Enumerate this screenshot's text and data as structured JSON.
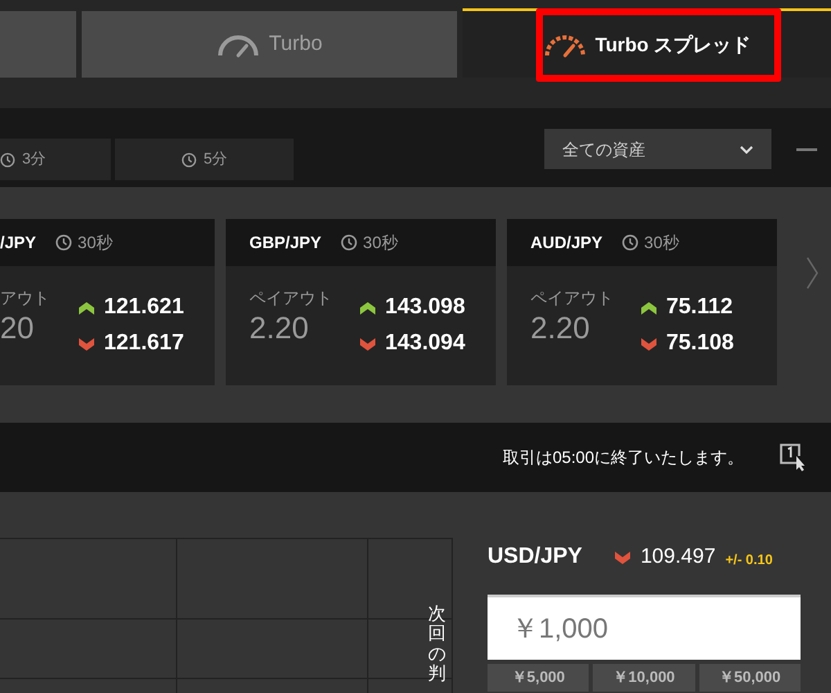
{
  "mode_tabs": [
    {
      "selected": false
    },
    {
      "label": "Turbo",
      "selected": false
    },
    {
      "label": "Turbo スプレッド",
      "selected": true,
      "highlighted": true
    }
  ],
  "duration_tabs": [
    {
      "label": "3分"
    },
    {
      "label": "5分"
    }
  ],
  "asset_filter": {
    "value": "全ての資産"
  },
  "cards": [
    {
      "kind": "partial",
      "pair": "/JPY",
      "duration": "30秒",
      "payout_label": "アウト",
      "payout": "20",
      "up_price": "121.621",
      "down_price": "121.617"
    },
    {
      "kind": "full",
      "pair": "GBP/JPY",
      "duration": "30秒",
      "payout_label": "ペイアウト",
      "payout": "2.20",
      "up_price": "143.098",
      "down_price": "143.094"
    },
    {
      "kind": "full",
      "pair": "AUD/JPY",
      "duration": "30秒",
      "payout_label": "ペイアウト",
      "payout": "2.20",
      "up_price": "75.112",
      "down_price": "75.108"
    }
  ],
  "notice": "取引は05:00に終了いたします。",
  "chart_side_label": "次回の判",
  "trade_panel": {
    "pair": "USD/JPY",
    "price_falling": true,
    "price": "109.497",
    "spread": "+/- 0.10",
    "amount": "￥1,000",
    "presets": [
      "￥5,000",
      "￥10,000",
      "￥50,000"
    ]
  }
}
